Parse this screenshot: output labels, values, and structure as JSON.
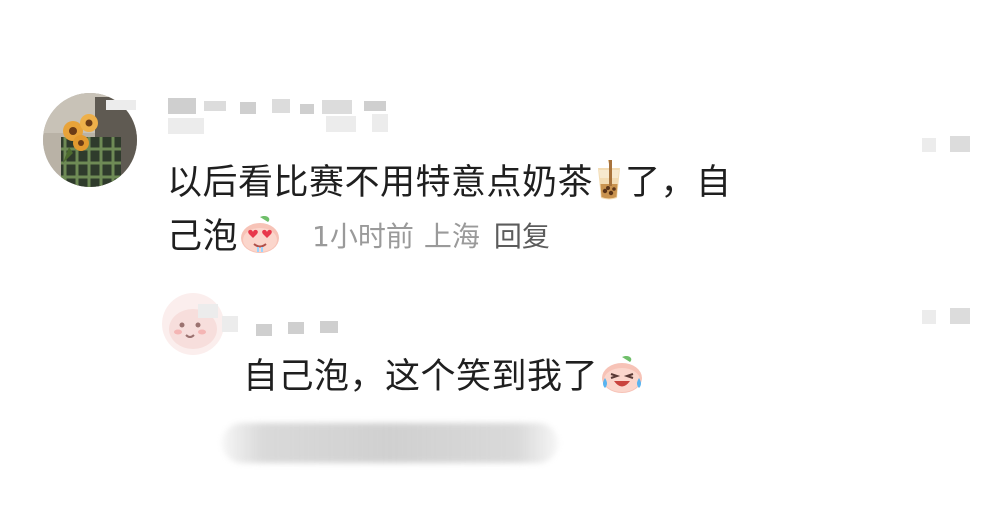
{
  "comment": {
    "text_line1": "以后看比赛不用特意点奶茶",
    "text_line1_tail": "了，自",
    "text_line2": "己泡",
    "time": "1小时前",
    "location": "上海",
    "reply_label": "回复"
  },
  "reply": {
    "text": "自己泡，这个笑到我了"
  },
  "icons": {
    "tea_emoji": "bubble-tea-icon",
    "heart_eyes_emoji": "heart-eyes-peach-icon",
    "laugh_cry_emoji": "laugh-cry-peach-icon"
  }
}
